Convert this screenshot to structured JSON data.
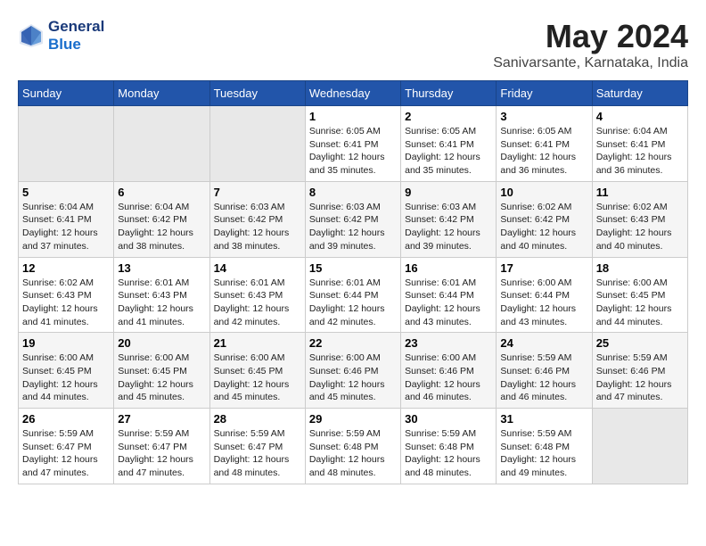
{
  "header": {
    "logo_line1": "General",
    "logo_line2": "Blue",
    "title": "May 2024",
    "location": "Sanivarsante, Karnataka, India"
  },
  "days_of_week": [
    "Sunday",
    "Monday",
    "Tuesday",
    "Wednesday",
    "Thursday",
    "Friday",
    "Saturday"
  ],
  "weeks": [
    [
      {
        "day": "",
        "info": ""
      },
      {
        "day": "",
        "info": ""
      },
      {
        "day": "",
        "info": ""
      },
      {
        "day": "1",
        "info": "Sunrise: 6:05 AM\nSunset: 6:41 PM\nDaylight: 12 hours\nand 35 minutes."
      },
      {
        "day": "2",
        "info": "Sunrise: 6:05 AM\nSunset: 6:41 PM\nDaylight: 12 hours\nand 35 minutes."
      },
      {
        "day": "3",
        "info": "Sunrise: 6:05 AM\nSunset: 6:41 PM\nDaylight: 12 hours\nand 36 minutes."
      },
      {
        "day": "4",
        "info": "Sunrise: 6:04 AM\nSunset: 6:41 PM\nDaylight: 12 hours\nand 36 minutes."
      }
    ],
    [
      {
        "day": "5",
        "info": "Sunrise: 6:04 AM\nSunset: 6:41 PM\nDaylight: 12 hours\nand 37 minutes."
      },
      {
        "day": "6",
        "info": "Sunrise: 6:04 AM\nSunset: 6:42 PM\nDaylight: 12 hours\nand 38 minutes."
      },
      {
        "day": "7",
        "info": "Sunrise: 6:03 AM\nSunset: 6:42 PM\nDaylight: 12 hours\nand 38 minutes."
      },
      {
        "day": "8",
        "info": "Sunrise: 6:03 AM\nSunset: 6:42 PM\nDaylight: 12 hours\nand 39 minutes."
      },
      {
        "day": "9",
        "info": "Sunrise: 6:03 AM\nSunset: 6:42 PM\nDaylight: 12 hours\nand 39 minutes."
      },
      {
        "day": "10",
        "info": "Sunrise: 6:02 AM\nSunset: 6:42 PM\nDaylight: 12 hours\nand 40 minutes."
      },
      {
        "day": "11",
        "info": "Sunrise: 6:02 AM\nSunset: 6:43 PM\nDaylight: 12 hours\nand 40 minutes."
      }
    ],
    [
      {
        "day": "12",
        "info": "Sunrise: 6:02 AM\nSunset: 6:43 PM\nDaylight: 12 hours\nand 41 minutes."
      },
      {
        "day": "13",
        "info": "Sunrise: 6:01 AM\nSunset: 6:43 PM\nDaylight: 12 hours\nand 41 minutes."
      },
      {
        "day": "14",
        "info": "Sunrise: 6:01 AM\nSunset: 6:43 PM\nDaylight: 12 hours\nand 42 minutes."
      },
      {
        "day": "15",
        "info": "Sunrise: 6:01 AM\nSunset: 6:44 PM\nDaylight: 12 hours\nand 42 minutes."
      },
      {
        "day": "16",
        "info": "Sunrise: 6:01 AM\nSunset: 6:44 PM\nDaylight: 12 hours\nand 43 minutes."
      },
      {
        "day": "17",
        "info": "Sunrise: 6:00 AM\nSunset: 6:44 PM\nDaylight: 12 hours\nand 43 minutes."
      },
      {
        "day": "18",
        "info": "Sunrise: 6:00 AM\nSunset: 6:45 PM\nDaylight: 12 hours\nand 44 minutes."
      }
    ],
    [
      {
        "day": "19",
        "info": "Sunrise: 6:00 AM\nSunset: 6:45 PM\nDaylight: 12 hours\nand 44 minutes."
      },
      {
        "day": "20",
        "info": "Sunrise: 6:00 AM\nSunset: 6:45 PM\nDaylight: 12 hours\nand 45 minutes."
      },
      {
        "day": "21",
        "info": "Sunrise: 6:00 AM\nSunset: 6:45 PM\nDaylight: 12 hours\nand 45 minutes."
      },
      {
        "day": "22",
        "info": "Sunrise: 6:00 AM\nSunset: 6:46 PM\nDaylight: 12 hours\nand 45 minutes."
      },
      {
        "day": "23",
        "info": "Sunrise: 6:00 AM\nSunset: 6:46 PM\nDaylight: 12 hours\nand 46 minutes."
      },
      {
        "day": "24",
        "info": "Sunrise: 5:59 AM\nSunset: 6:46 PM\nDaylight: 12 hours\nand 46 minutes."
      },
      {
        "day": "25",
        "info": "Sunrise: 5:59 AM\nSunset: 6:46 PM\nDaylight: 12 hours\nand 47 minutes."
      }
    ],
    [
      {
        "day": "26",
        "info": "Sunrise: 5:59 AM\nSunset: 6:47 PM\nDaylight: 12 hours\nand 47 minutes."
      },
      {
        "day": "27",
        "info": "Sunrise: 5:59 AM\nSunset: 6:47 PM\nDaylight: 12 hours\nand 47 minutes."
      },
      {
        "day": "28",
        "info": "Sunrise: 5:59 AM\nSunset: 6:47 PM\nDaylight: 12 hours\nand 48 minutes."
      },
      {
        "day": "29",
        "info": "Sunrise: 5:59 AM\nSunset: 6:48 PM\nDaylight: 12 hours\nand 48 minutes."
      },
      {
        "day": "30",
        "info": "Sunrise: 5:59 AM\nSunset: 6:48 PM\nDaylight: 12 hours\nand 48 minutes."
      },
      {
        "day": "31",
        "info": "Sunrise: 5:59 AM\nSunset: 6:48 PM\nDaylight: 12 hours\nand 49 minutes."
      },
      {
        "day": "",
        "info": ""
      }
    ]
  ]
}
